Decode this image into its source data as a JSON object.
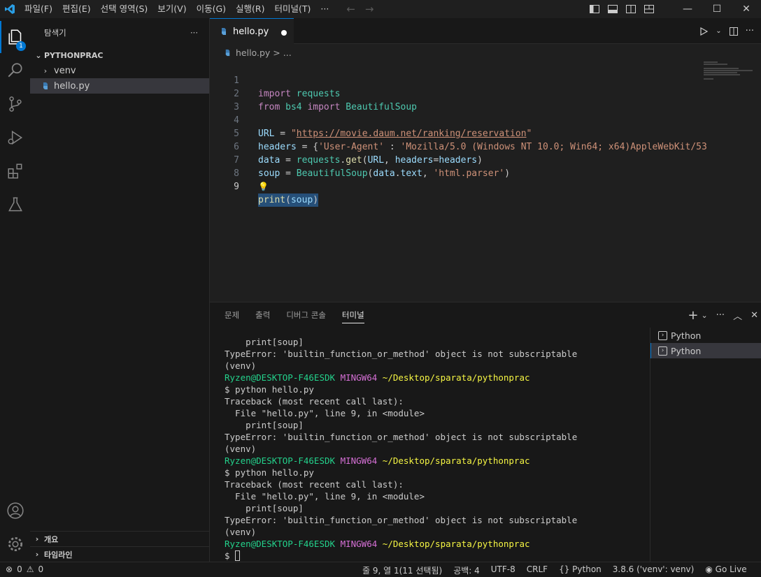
{
  "titlebar": {
    "menu": [
      "파일(F)",
      "편집(E)",
      "선택 영역(S)",
      "보기(V)",
      "이동(G)",
      "실행(R)",
      "터미널(T)",
      "···"
    ]
  },
  "activity": {
    "explorer_badge": "1",
    "icons": [
      "files-icon",
      "search-icon",
      "source-control-icon",
      "run-debug-icon",
      "extensions-icon",
      "testing-icon",
      "account-icon",
      "gear-icon"
    ]
  },
  "sidebar": {
    "title": "탐색기",
    "more": "···",
    "folder": "PYTHONPRAC",
    "items": [
      {
        "label": "venv"
      },
      {
        "label": "hello.py"
      }
    ],
    "outline": "개요",
    "timeline": "타임라인"
  },
  "editor": {
    "tab_label": "hello.py",
    "breadcrumb_file": "hello.py",
    "breadcrumb_rest": "> ...",
    "line_numbers": [
      "1",
      "2",
      "3",
      "4",
      "5",
      "6",
      "7",
      "8",
      "9"
    ]
  },
  "code": {
    "l1_kw": "import",
    "l1_mod": "requests",
    "l2_kw": "from",
    "l2_mod": "bs4",
    "l2_kw2": "import",
    "l2_cls": "BeautifulSoup",
    "l4_var": "URL",
    "l4_eq": " = ",
    "l4_q1": "\"",
    "l4_url": "https://movie.daum.net/ranking/reservation",
    "l4_q2": "\"",
    "l5_var": "headers",
    "l5_eq": " = {",
    "l5_key": "'User-Agent'",
    "l5_colon": " : ",
    "l5_val": "'Mozilla/5.0 (Windows NT 10.0; Win64; x64)AppleWebKit/53",
    "l6_var": "data",
    "l6_eq": " = ",
    "l6_mod": "requests",
    "l6_dot": ".",
    "l6_fn": "get",
    "l6_p1": "(",
    "l6_a1": "URL",
    "l6_c": ", ",
    "l6_a2": "headers",
    "l6_eq2": "=",
    "l6_a3": "headers",
    "l6_p2": ")",
    "l7_var": "soup",
    "l7_eq": " = ",
    "l7_cls": "BeautifulSoup",
    "l7_p1": "(",
    "l7_a1": "data",
    "l7_dot": ".",
    "l7_a2": "text",
    "l7_c": ", ",
    "l7_str": "'html.parser'",
    "l7_p2": ")",
    "l8_bulb": "💡",
    "l9_fn": "print",
    "l9_p1": "(",
    "l9_a": "soup",
    "l9_p2": ")"
  },
  "panel": {
    "tabs": [
      "문제",
      "출력",
      "디버그 콘솔",
      "터미널"
    ],
    "terminals": [
      "Python",
      "Python"
    ]
  },
  "terminal": {
    "lines": [
      {
        "text": "    print[soup]"
      },
      {
        "text": "TypeError: 'builtin_function_or_method' object is not subscriptable"
      },
      {
        "text": "(venv)"
      },
      {
        "prompt": true,
        "user": "Ryzen@DESKTOP-F46ESDK",
        "sys": "MINGW64",
        "path": "~/Desktop/sparata/pythonprac"
      },
      {
        "text": "$ python hello.py"
      },
      {
        "text": "Traceback (most recent call last):"
      },
      {
        "text": "  File \"hello.py\", line 9, in <module>"
      },
      {
        "text": "    print[soup]"
      },
      {
        "text": "TypeError: 'builtin_function_or_method' object is not subscriptable"
      },
      {
        "text": "(venv)"
      },
      {
        "prompt": true,
        "user": "Ryzen@DESKTOP-F46ESDK",
        "sys": "MINGW64",
        "path": "~/Desktop/sparata/pythonprac"
      },
      {
        "text": "$ python hello.py"
      },
      {
        "text": "Traceback (most recent call last):"
      },
      {
        "text": "  File \"hello.py\", line 9, in <module>"
      },
      {
        "text": "    print[soup]"
      },
      {
        "text": "TypeError: 'builtin_function_or_method' object is not subscriptable"
      },
      {
        "text": "(venv)"
      },
      {
        "prompt": true,
        "user": "Ryzen@DESKTOP-F46ESDK",
        "sys": "MINGW64",
        "path": "~/Desktop/sparata/pythonprac"
      },
      {
        "text": "$ ",
        "cursor": true
      }
    ]
  },
  "statusbar": {
    "errors": "0",
    "warnings": "0",
    "position": "줄 9, 열 1(11 선택됨)",
    "spaces": "공백: 4",
    "encoding": "UTF-8",
    "eol": "CRLF",
    "language": "Python",
    "interpreter": "3.8.6 ('venv': venv)",
    "golive": "Go Live"
  },
  "colors": {
    "accent": "#0078d4",
    "terminal_user": "#23d18b",
    "terminal_sys": "#d670d6",
    "terminal_path": "#f5f543"
  }
}
